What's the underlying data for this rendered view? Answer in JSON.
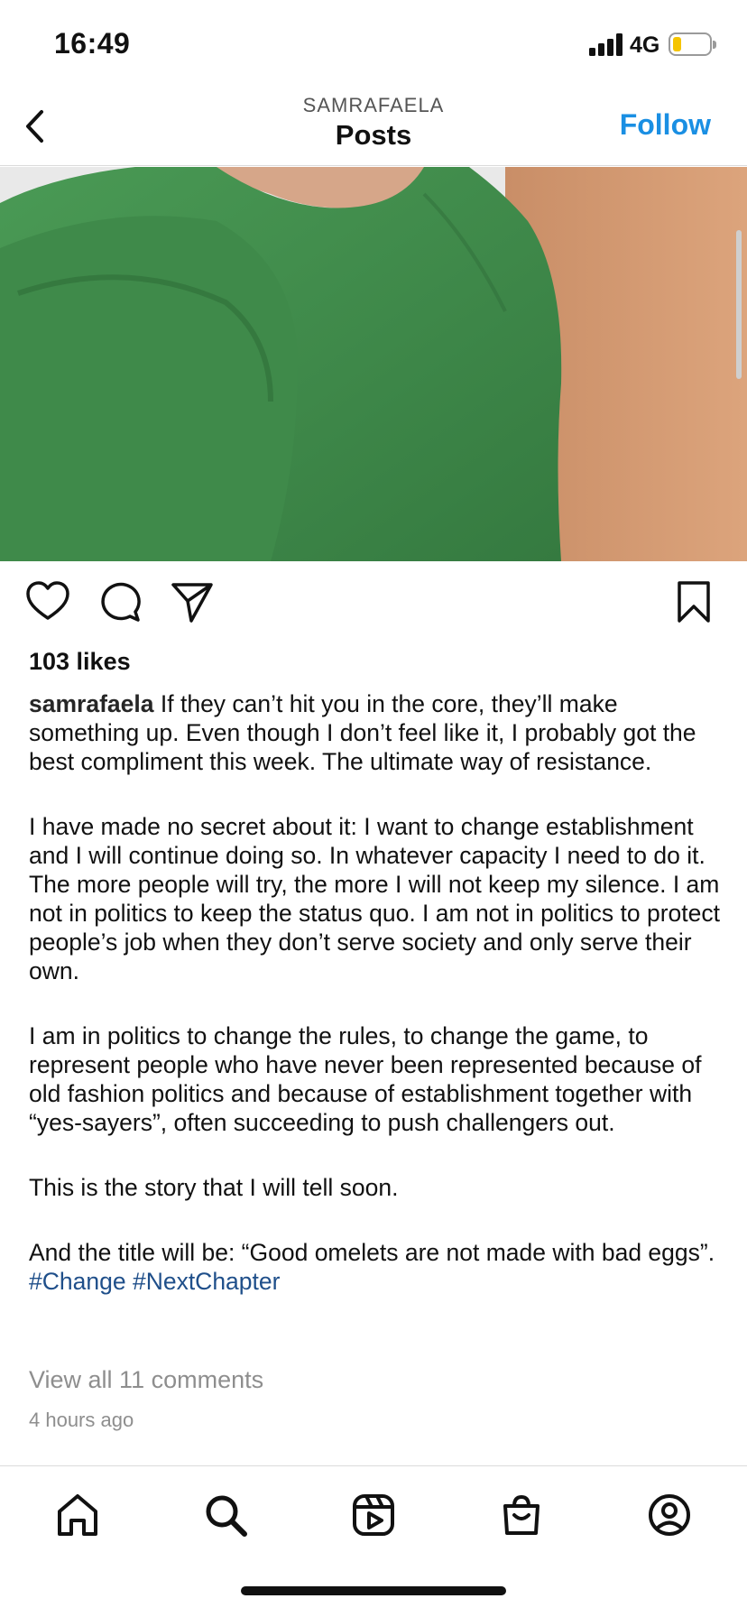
{
  "status_bar": {
    "time": "16:49",
    "network": "4G",
    "battery_color": "#f5c400"
  },
  "header": {
    "username": "SAMRAFAELA",
    "title": "Posts",
    "follow_label": "Follow",
    "follow_color": "#1a8fe3",
    "back_icon": "chevron-left-icon"
  },
  "post": {
    "image_description_colors": {
      "shirt": "#3f8a4a",
      "background_right": "#d19a72",
      "background_left": "#e9e9e9"
    },
    "actions": [
      "heart-icon",
      "comment-icon",
      "share-icon",
      "bookmark-icon"
    ],
    "likes": "103 likes",
    "caption": {
      "username": "samrafaela",
      "p1": "If they can’t hit you in the core, they’ll make something up. Even though I don’t feel like it, I probably got the best compliment this week. The ultimate way of resistance.",
      "p2": "I have made no secret about it: I want to change establishment and I will continue doing so. In whatever capacity I need to do it. The more people will try, the more I will not keep my silence. I am not in politics to keep the status quo. I am not in politics to protect people’s job when they don’t serve society and only serve their own.",
      "p3": "I am in politics to change the rules, to change the game, to represent people who have never been represented because of old fashion politics and because of establishment together with “yes-sayers”, often succeeding to push challengers out.",
      "p4": "This is the story that I will tell soon.",
      "p5": "And the title will be: “Good omelets are not made with bad eggs”.",
      "hashtag1": "#Change",
      "hashtag2": "#NextChapter"
    },
    "view_comments": "View all 11 comments",
    "time_ago": "4 hours ago"
  },
  "tabbar": {
    "items": [
      "home-icon",
      "search-icon",
      "reels-icon",
      "shop-icon",
      "profile-icon"
    ]
  }
}
